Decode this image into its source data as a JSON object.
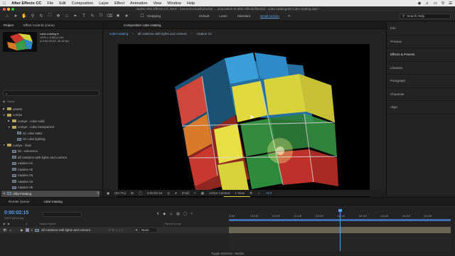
{
  "menubar": {
    "app": "After Effects CC",
    "items": [
      "File",
      "Edit",
      "Composition",
      "Layer",
      "Effect",
      "Animation",
      "View",
      "Window",
      "Help"
    ]
  },
  "titlebar": {
    "text": "Adobe After Effects CC 2019 - /Users/michaelbuhe/De ... omposition-in-after-effects/files/3d - cube-rotating/3d-cube-rotating.aep *"
  },
  "toolbar": {
    "snapping": "Snapping",
    "workspaces": [
      "Default",
      "Learn",
      "Standard",
      "Small Screen"
    ],
    "active_workspace": "Small Screen",
    "search_placeholder": "Search Help"
  },
  "project": {
    "tabs": [
      "Project",
      "Effect Controls (none)"
    ],
    "selected_name": "cube-rotating ▾",
    "info_lines": [
      "1920 x 1080 (1.00)",
      "Δ 0:00:25:00, 30.00 fps"
    ],
    "search_placeholder": "⌕",
    "column_name": "Name",
    "tree": [
      {
        "label": "assets",
        "type": "folder",
        "indent": 0,
        "twirl": "▶"
      },
      {
        "label": "comps",
        "type": "folder",
        "indent": 0,
        "twirl": "▼"
      },
      {
        "label": "comps - cube solid",
        "type": "folder",
        "indent": 1,
        "twirl": "▶"
      },
      {
        "label": "comps - cube transparent",
        "type": "folder",
        "indent": 1,
        "twirl": "▼"
      },
      {
        "label": "01 cube static",
        "type": "comp",
        "indent": 2,
        "twirl": ""
      },
      {
        "label": "02 cube lighting",
        "type": "comp",
        "indent": 2,
        "twirl": ""
      },
      {
        "label": "comps - final",
        "type": "folder",
        "indent": 0,
        "twirl": "▼"
      },
      {
        "label": "00 - reference",
        "type": "comp",
        "indent": 1,
        "twirl": ""
      },
      {
        "label": "all rotations with lights and camera",
        "type": "comp",
        "indent": 1,
        "twirl": ""
      },
      {
        "label": "rotation 01",
        "type": "comp",
        "indent": 1,
        "twirl": ""
      },
      {
        "label": "rotation 02",
        "type": "comp",
        "indent": 1,
        "twirl": ""
      },
      {
        "label": "rotation 03",
        "type": "comp",
        "indent": 1,
        "twirl": ""
      },
      {
        "label": "rotation 04",
        "type": "comp",
        "indent": 1,
        "twirl": ""
      },
      {
        "label": "rotation 05",
        "type": "comp",
        "indent": 1,
        "twirl": ""
      },
      {
        "label": "cube-rotating",
        "type": "comp",
        "indent": 0,
        "twirl": "",
        "selected": true
      }
    ],
    "footer_bpc": "8 bpc"
  },
  "composition": {
    "tab": "Composition cube-rotating",
    "breadcrumbs": [
      "cube-rotating",
      "all rotations with lights and camera",
      "rotation 03"
    ],
    "footer": {
      "zoom": "(83.7%)",
      "timecode": "0:00:02:15",
      "resolution": "(Full)",
      "camera": "Active Camera",
      "views": "1 View",
      "exposure": "+0.0"
    }
  },
  "right_panels": [
    "Info",
    "Preview",
    "Effects & Presets",
    "Libraries",
    "Paragraph",
    "Character",
    "Align"
  ],
  "timeline": {
    "tabs": [
      "Render Queue",
      "cube-rotating"
    ],
    "timecode": "0:00:02:15",
    "timecode_sub": "00075 (30.00 fps)",
    "columns": [
      "#",
      "Source Name",
      "Parent & Link"
    ],
    "layer": {
      "index": "1",
      "name": "all rotations with lights and camera",
      "parent": "None"
    },
    "ruler_labels": [
      "0:00f",
      "00:15f",
      "01:00f",
      "01:15f",
      "02:00f",
      "02:15f",
      "03:00f",
      "03:15f",
      "04:00f",
      "04:15f"
    ],
    "playhead_position": "0:00:02:15",
    "footer": "Toggle Switches / Modes"
  },
  "colors": {
    "accent": "#5aa0e6",
    "cube_yellow": "#d8d23a",
    "cube_red": "#c9382e",
    "cube_blue": "#2f8bc8",
    "cube_green": "#3a9a45",
    "cube_orange": "#d97a2a"
  }
}
